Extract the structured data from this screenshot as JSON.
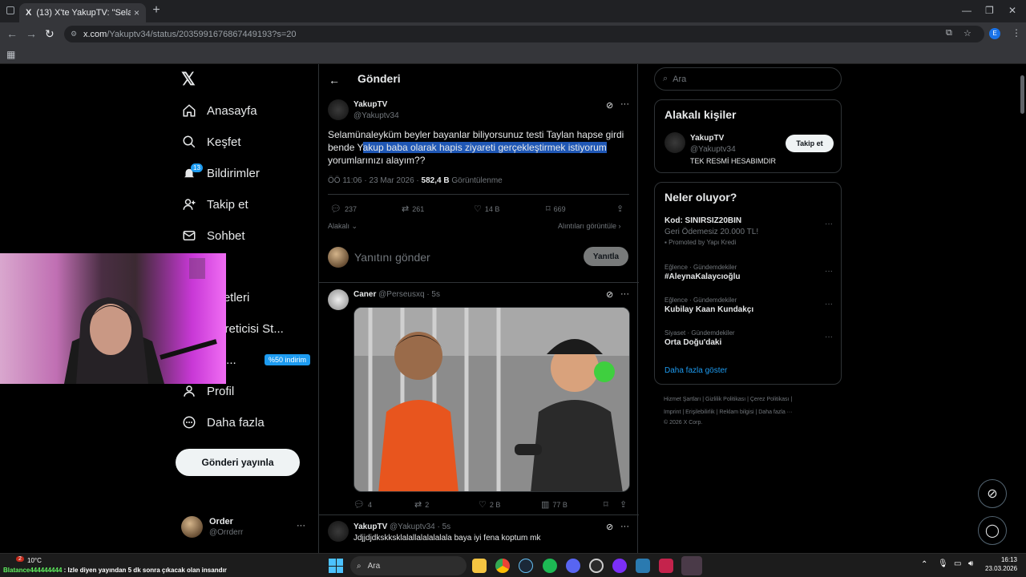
{
  "browser": {
    "tab_title": "(13) X'te YakupTV: \"Selamünaleyküm",
    "tab_logo": "X",
    "url_domain": "x.com",
    "url_path": "/Yakuptv34/status/2035991676867449193?s=20",
    "profile_letter": "E"
  },
  "sidebar": {
    "logo": "𝕏",
    "items": [
      {
        "label": "Anasayfa",
        "icon": "home-icon"
      },
      {
        "label": "Keşfet",
        "icon": "search-icon"
      },
      {
        "label": "Bildirimler",
        "icon": "bell-icon",
        "badge": "13"
      },
      {
        "label": "Takip et",
        "icon": "add-user-icon"
      },
      {
        "label": "Sohbet",
        "icon": "mail-icon"
      },
      {
        "label": "k",
        "icon": "grok-icon"
      },
      {
        "label": "şaretleri",
        "icon": "bookmark-icon"
      },
      {
        "label": "k Üreticisi St...",
        "icon": "creator-icon"
      },
      {
        "label": "miu...",
        "icon": "premium-icon",
        "promo": "%50 indirim"
      },
      {
        "label": "Profil",
        "icon": "user-icon"
      },
      {
        "label": "Daha fazla",
        "icon": "more-icon"
      }
    ],
    "post_button": "Gönderi yayınla",
    "account": {
      "name": "Order",
      "handle": "@Orrderr",
      "more": "···"
    }
  },
  "main": {
    "title": "Gönderi",
    "tweet": {
      "name": "YakupTV",
      "handle": "@Yakuptv34",
      "text_before": "Selamünaleyküm beyler bayanlar biliyorsunuz testi Taylan hapse girdi bende Y",
      "text_highlight": "akup baba olarak hapis ziyareti gerçekleştirmek istiyorum",
      "text_after": " yorumlarınızı alayım??",
      "time": "ÖÖ 11:06 · 23 Mar 2026 · ",
      "views_num": "582,4 B",
      "views_label": " Görüntülenme",
      "replies": "237",
      "retweets": "261",
      "likes": "14 B",
      "bookmarks": "669"
    },
    "related_label": "Alakalı",
    "quotes_label": "Alıntıları görüntüle",
    "reply_placeholder": "Yanıtını gönder",
    "reply_button": "Yanıtla",
    "reply1": {
      "name": "Caner",
      "handle": "@Perseusxq · 5s",
      "replies": "4",
      "retweets": "2",
      "likes": "2 B",
      "views": "77 B"
    },
    "reply2": {
      "name": "YakupTV",
      "handle": "@Yakuptv34 · 5s",
      "text": "Jdjjdjdkskksklalallalalalalala baya iyi fena koptum mk"
    }
  },
  "right": {
    "search_placeholder": "Ara",
    "related_title": "Alakalı kişiler",
    "person": {
      "name": "YakupTV",
      "handle": "@Yakuptv34",
      "bio": "TEK RESMİ HESABIMDIR",
      "follow": "Takip et"
    },
    "trends_title": "Neler oluyor?",
    "trends": [
      {
        "cat": "",
        "name": "Kod: SINIRSIZ20BIN",
        "sub": "Geri Ödemesiz 20.000 TL!",
        "promo": "Promoted by Yapı Kredi"
      },
      {
        "cat": "Eğlence · Gündemdekiler",
        "name": "#AleynaKalaycıoğlu"
      },
      {
        "cat": "Eğlence · Gündemdekiler",
        "name": "Kubilay Kaan Kundakçı"
      },
      {
        "cat": "Siyaset · Gündemdekiler",
        "name": "Orta Doğu'daki"
      }
    ],
    "show_more": "Daha fazla göster",
    "footer_line1": "Hizmet Şartları  |  Gizlilik Politikası  |  Çerez Politikası  |",
    "footer_line2": "Imprint  |  Erişilebilirlik  |  Reklam bilgisi  |  Daha fazla ···",
    "footer_line3": "© 2026 X Corp."
  },
  "taskbar": {
    "weather": "10°C",
    "weather_badge": "2",
    "search": "Ara",
    "ticker_user": "Blatance444444444",
    "ticker_msg": " : Izle diyen yayından 5 dk sonra çıkacak olan insandır",
    "time": "16:13",
    "date": "23.03.2026"
  }
}
